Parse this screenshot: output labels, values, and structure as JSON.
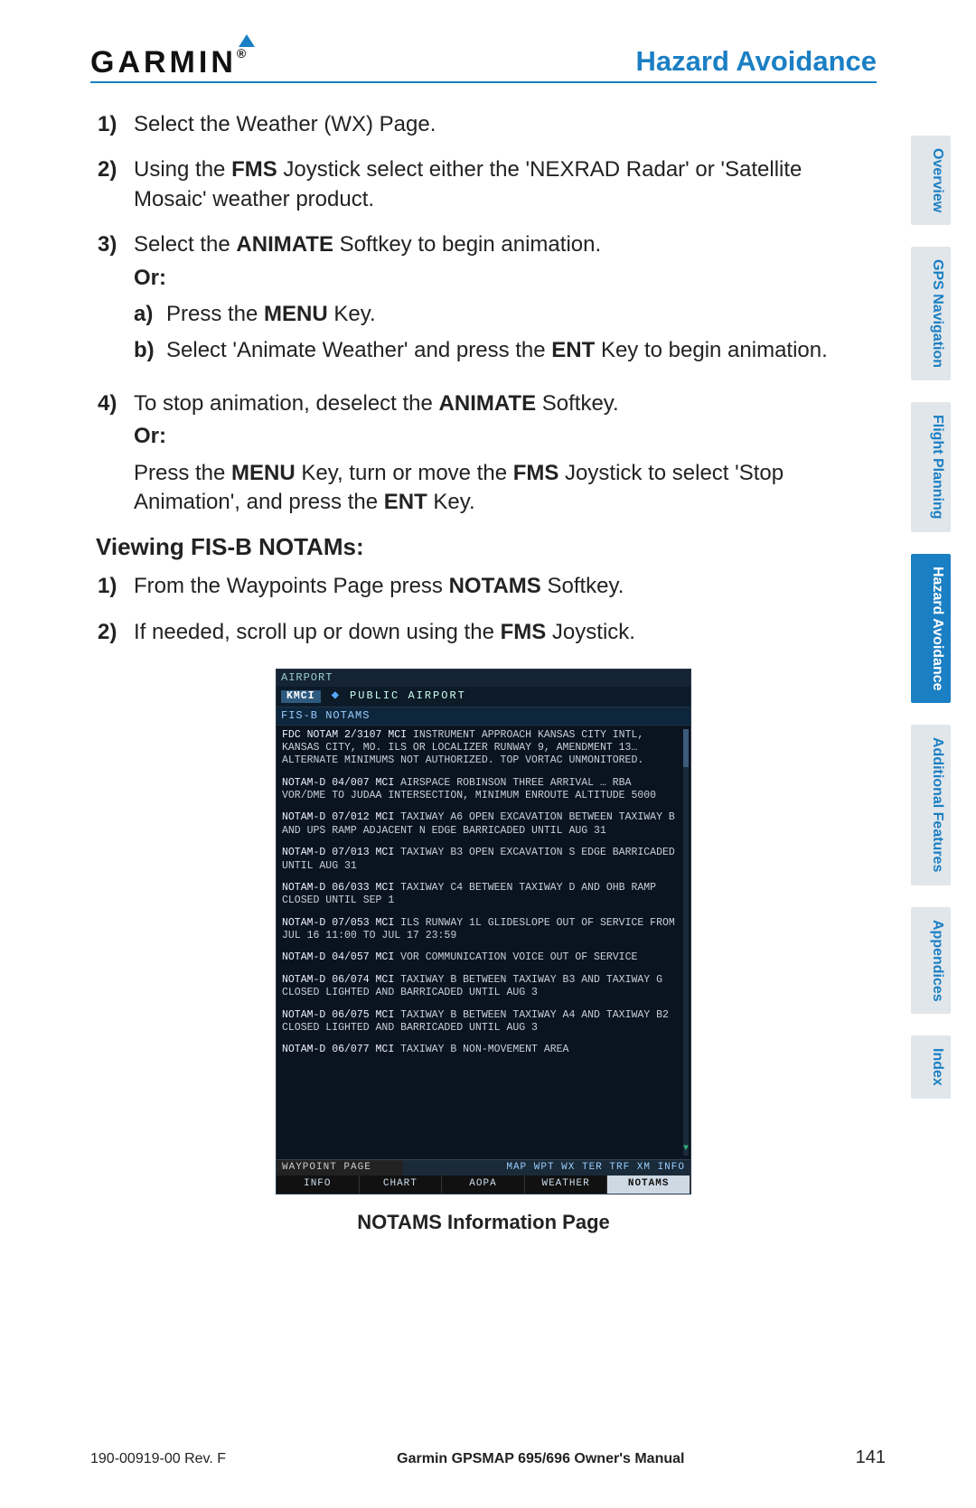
{
  "header": {
    "brand": "GARMIN",
    "brand_suffix": "®",
    "chapter": "Hazard Avoidance"
  },
  "steps_a": [
    {
      "n": "1)",
      "html": "Select the Weather (WX) Page."
    },
    {
      "n": "2)",
      "html": "Using the <b>FMS</b> Joystick select either the 'NEXRAD Radar' or 'Satellite Mosaic' weather product."
    },
    {
      "n": "3)",
      "html": "Select the <b>ANIMATE</b> Softkey to begin animation.",
      "or": "Or:",
      "sub": [
        {
          "sn": "a)",
          "html": "Press the <b>MENU</b> Key."
        },
        {
          "sn": "b)",
          "html": "Select 'Animate Weather' and press the <b>ENT</b> Key to begin animation."
        }
      ]
    },
    {
      "n": "4)",
      "html": "To stop animation, deselect the <b>ANIMATE</b> Softkey.",
      "or": "Or:",
      "tail": "Press the <b>MENU</b> Key, turn or move the <b>FMS</b> Joystick to select 'Stop Animation', and press the <b>ENT</b> Key."
    }
  ],
  "section_head": "Viewing FIS-B NOTAMs:",
  "steps_b": [
    {
      "n": "1)",
      "html": "From the Waypoints Page press <b>NOTAMS</b> Softkey."
    },
    {
      "n": "2)",
      "html": "If needed, scroll up or down using the <b>FMS</b> Joystick."
    }
  ],
  "device": {
    "top": "AIRPORT",
    "ident": "KMCI",
    "airport": "PUBLIC AIRPORT",
    "section": "FIS-B NOTAMS",
    "notams": [
      {
        "id": "FDC NOTAM 2/3107 MCI",
        "body": "INSTRUMENT APPROACH KANSAS CITY INTL, KANSAS CITY, MO. ILS OR LOCALIZER RUNWAY 9, AMENDMENT 13… ALTERNATE MINIMUMS NOT AUTHORIZED. TOP VORTAC UNMONITORED."
      },
      {
        "id": "NOTAM-D 04/007 MCI",
        "body": "AIRSPACE ROBINSON THREE ARRIVAL … RBA VOR/DME TO JUDAA INTERSECTION, MINIMUM ENROUTE ALTITUDE 5000"
      },
      {
        "id": "NOTAM-D 07/012 MCI",
        "body": "TAXIWAY A6 OPEN EXCAVATION BETWEEN TAXIWAY B AND UPS RAMP ADJACENT N EDGE BARRICADED UNTIL AUG 31"
      },
      {
        "id": "NOTAM-D 07/013 MCI",
        "body": "TAXIWAY B3 OPEN EXCAVATION S EDGE BARRICADED UNTIL AUG 31"
      },
      {
        "id": "NOTAM-D 06/033 MCI",
        "body": "TAXIWAY C4 BETWEEN TAXIWAY D AND OHB RAMP CLOSED UNTIL SEP 1"
      },
      {
        "id": "NOTAM-D 07/053 MCI",
        "body": "ILS RUNWAY 1L GLIDESLOPE OUT OF SERVICE FROM JUL 16 11:00 TO JUL 17 23:59"
      },
      {
        "id": "NOTAM-D 04/057 MCI",
        "body": "VOR COMMUNICATION VOICE OUT OF SERVICE"
      },
      {
        "id": "NOTAM-D 06/074 MCI",
        "body": "TAXIWAY B BETWEEN TAXIWAY B3 AND TAXIWAY G CLOSED LIGHTED AND BARRICADED UNTIL AUG 3"
      },
      {
        "id": "NOTAM-D 06/075 MCI",
        "body": "TAXIWAY B BETWEEN TAXIWAY A4 AND TAXIWAY B2 CLOSED LIGHTED AND BARRICADED UNTIL AUG 3"
      },
      {
        "id": "NOTAM-D 06/077 MCI",
        "body": "TAXIWAY B NON-MOVEMENT AREA"
      }
    ],
    "foot_page": "WAYPOINT PAGE",
    "foot_tabs": "MAP WPT WX TER TRF XM INFO",
    "softkeys": [
      "INFO",
      "CHART",
      "AOPA",
      "WEATHER",
      "NOTAMS"
    ],
    "softkey_active": 4
  },
  "caption": "NOTAMS Information Page",
  "side_tabs": [
    {
      "label": "Overview",
      "active": false
    },
    {
      "label": "GPS Navigation",
      "active": false
    },
    {
      "label": "Flight Planning",
      "active": false
    },
    {
      "label": "Hazard Avoidance",
      "active": true
    },
    {
      "label": "Additional Features",
      "active": false
    },
    {
      "label": "Appendices",
      "active": false
    },
    {
      "label": "Index",
      "active": false
    }
  ],
  "footer": {
    "left": "190-00919-00 Rev. F",
    "center": "Garmin GPSMAP 695/696 Owner's Manual",
    "page": "141"
  }
}
